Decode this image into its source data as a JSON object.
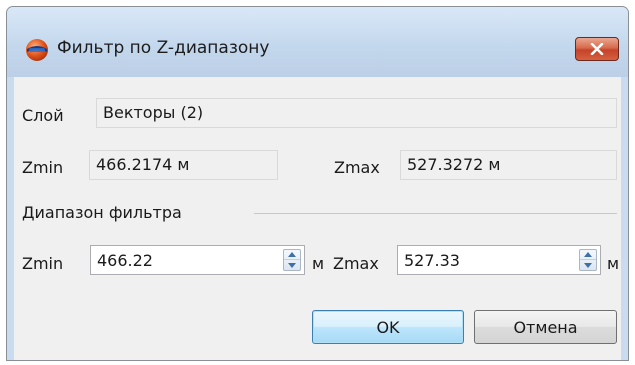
{
  "dialog": {
    "title": "Фильтр по Z-диапазону",
    "icon": "layers-globe-icon",
    "close_icon": "close-icon"
  },
  "layer": {
    "label": "Слой",
    "value": "Векторы (2)"
  },
  "source_range": {
    "zmin_label": "Zmin",
    "zmin_value": "466.2174 м",
    "zmax_label": "Zmax",
    "zmax_value": "527.3272 м"
  },
  "filter_range": {
    "group_label": "Диапазон фильтра",
    "zmin_label": "Zmin",
    "zmin_value": "466.22",
    "zmin_unit": "м",
    "zmax_label": "Zmax",
    "zmax_value": "527.33",
    "zmax_unit": "м"
  },
  "buttons": {
    "ok": "OK",
    "cancel": "Отмена"
  },
  "colors": {
    "titlebar": "#c9dbee",
    "client": "#f0f0f0",
    "close_button": "#d86a4c",
    "default_button_border": "#3c7fb1"
  }
}
